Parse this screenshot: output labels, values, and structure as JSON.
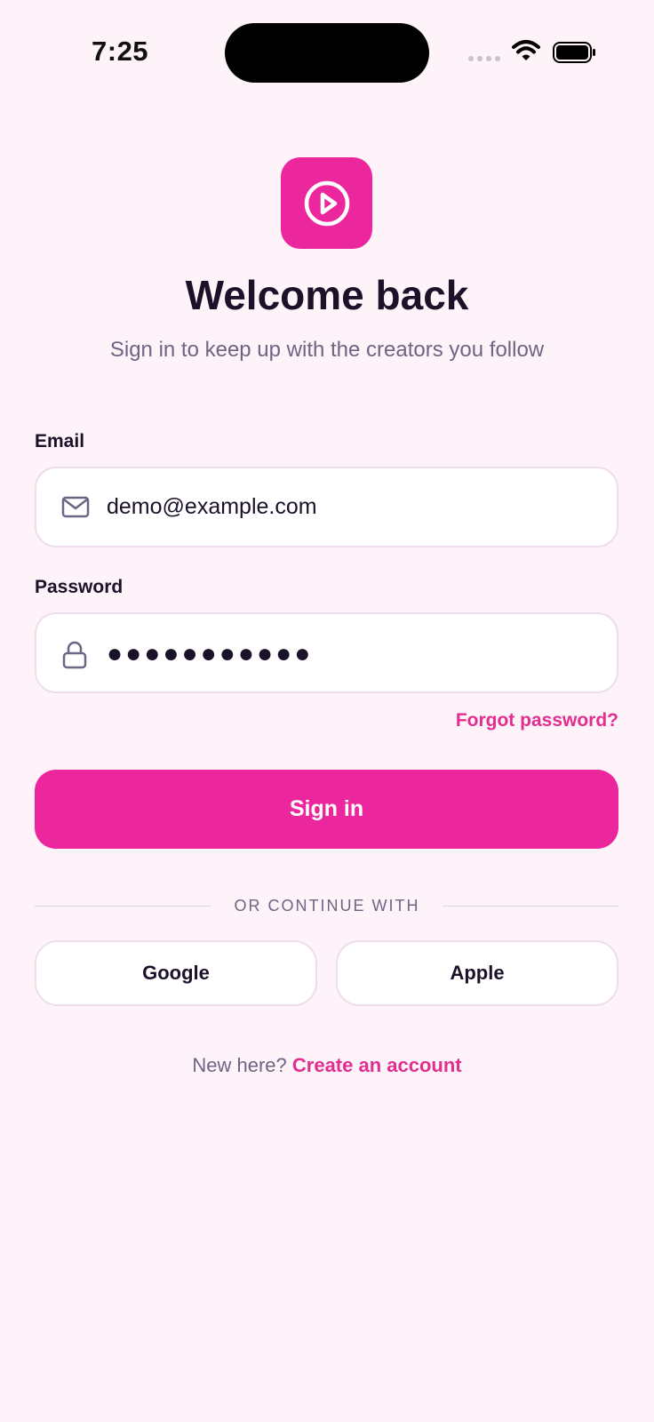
{
  "status_bar": {
    "time": "7:25"
  },
  "header": {
    "logo_icon": "play-circle-icon",
    "title": "Welcome back",
    "subtitle": "Sign in to keep up with the creators you follow"
  },
  "form": {
    "email": {
      "label": "Email",
      "value": "demo@example.com",
      "icon": "mail-icon"
    },
    "password": {
      "label": "Password",
      "masked_value": "●●●●●●●●●●●",
      "icon": "lock-icon"
    },
    "forgot_label": "Forgot password?",
    "submit_label": "Sign in"
  },
  "divider": {
    "label": "OR CONTINUE WITH"
  },
  "social": {
    "google_label": "Google",
    "apple_label": "Apple"
  },
  "footer": {
    "prompt": "New here?",
    "link": "Create an account"
  },
  "colors": {
    "accent": "#EC279D",
    "background": "#FEF3F9",
    "text": "#1B1129",
    "muted": "#6E6483"
  }
}
